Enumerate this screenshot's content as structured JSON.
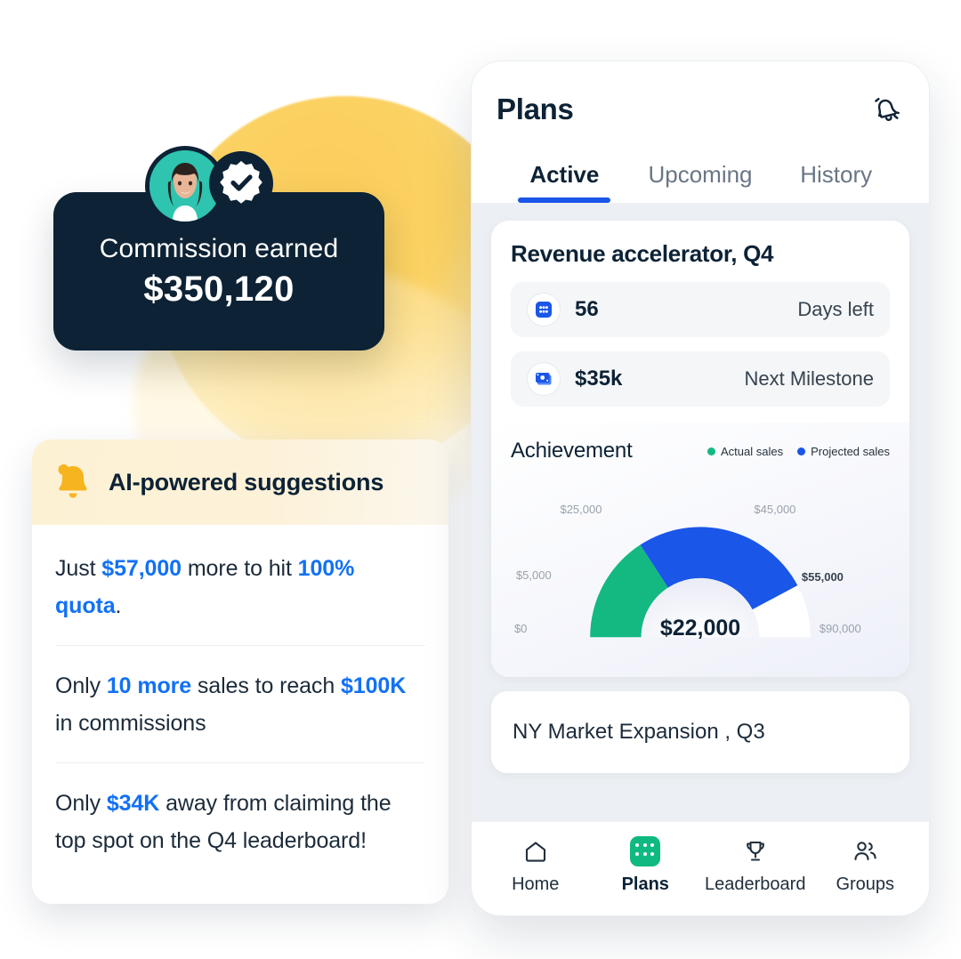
{
  "commission": {
    "label": "Commission earned",
    "value": "$350,120",
    "avatar_name": "user-avatar",
    "badge_icon": "verified-check-icon"
  },
  "suggestions": {
    "title": "AI-powered suggestions",
    "bell_icon": "bell-icon",
    "items": [
      {
        "parts": [
          {
            "t": "Just ",
            "hl": false
          },
          {
            "t": "$57,000",
            "hl": true
          },
          {
            "t": " more to hit ",
            "hl": false
          },
          {
            "t": "100% quota",
            "hl": true
          },
          {
            "t": ".",
            "hl": false
          }
        ]
      },
      {
        "parts": [
          {
            "t": "Only ",
            "hl": false
          },
          {
            "t": "10 more",
            "hl": true
          },
          {
            "t": " sales to reach ",
            "hl": false
          },
          {
            "t": "$100K",
            "hl": true
          },
          {
            "t": " in commissions",
            "hl": false
          }
        ]
      },
      {
        "parts": [
          {
            "t": "Only ",
            "hl": false
          },
          {
            "t": "$34K",
            "hl": true
          },
          {
            "t": " away from claiming the top spot on the Q4 leaderboard!",
            "hl": false
          }
        ]
      }
    ]
  },
  "phone": {
    "title": "Plans",
    "notification_icon": "bell-ring-icon",
    "tabs": [
      {
        "label": "Active",
        "active": true
      },
      {
        "label": "Upcoming",
        "active": false
      },
      {
        "label": "History",
        "active": false
      }
    ],
    "plan": {
      "name": "Revenue accelerator, Q4",
      "stats": [
        {
          "icon": "calendar-icon",
          "value": "56",
          "label": "Days left"
        },
        {
          "icon": "cash-icon",
          "value": "$35k",
          "label": "Next Milestone"
        }
      ],
      "achievement_title": "Achievement"
    },
    "next_plan": {
      "title": "NY Market Expansion , Q3"
    },
    "nav": [
      {
        "label": "Home",
        "icon": "home-icon",
        "active": false
      },
      {
        "label": "Plans",
        "icon": "plans-grid-icon",
        "active": true
      },
      {
        "label": "Leaderboard",
        "icon": "trophy-icon",
        "active": false
      },
      {
        "label": "Groups",
        "icon": "people-icon",
        "active": false
      }
    ]
  },
  "chart_data": {
    "type": "pie",
    "chart_subtype": "gauge",
    "title": "Achievement",
    "center_value": "$22,000",
    "center_value_number": 22000,
    "min": 0,
    "max": 90000,
    "start_angle_deg": 180,
    "end_angle_deg": 360,
    "legend_position": "top-right",
    "legend": [
      {
        "name": "Actual sales",
        "color": "#13b981"
      },
      {
        "name": "Projected sales",
        "color": "#1a56e8"
      }
    ],
    "series": [
      {
        "name": "Actual sales",
        "from": 0,
        "to": 25000,
        "color": "#13b981",
        "sweep_deg": 57
      },
      {
        "name": "Projected sales",
        "from": 25000,
        "to": 55000,
        "color": "#1a56e8",
        "sweep_deg": 95
      },
      {
        "name": "Remaining",
        "from": 55000,
        "to": 90000,
        "color": "#ffffff",
        "sweep_deg": 28
      }
    ],
    "tick_labels": [
      {
        "text": "$0",
        "value": 0,
        "emphasis": false
      },
      {
        "text": "$5,000",
        "value": 5000,
        "emphasis": false
      },
      {
        "text": "$25,000",
        "value": 25000,
        "emphasis": false
      },
      {
        "text": "$45,000",
        "value": 45000,
        "emphasis": false
      },
      {
        "text": "$55,000",
        "value": 55000,
        "emphasis": true
      },
      {
        "text": "$90,000",
        "value": 90000,
        "emphasis": false
      }
    ],
    "grid": false
  },
  "colors": {
    "accent_blue": "#1a56e8",
    "link_blue": "#1271f5",
    "green": "#13b981",
    "navy": "#0d2235",
    "amber": "#f6b51e"
  }
}
